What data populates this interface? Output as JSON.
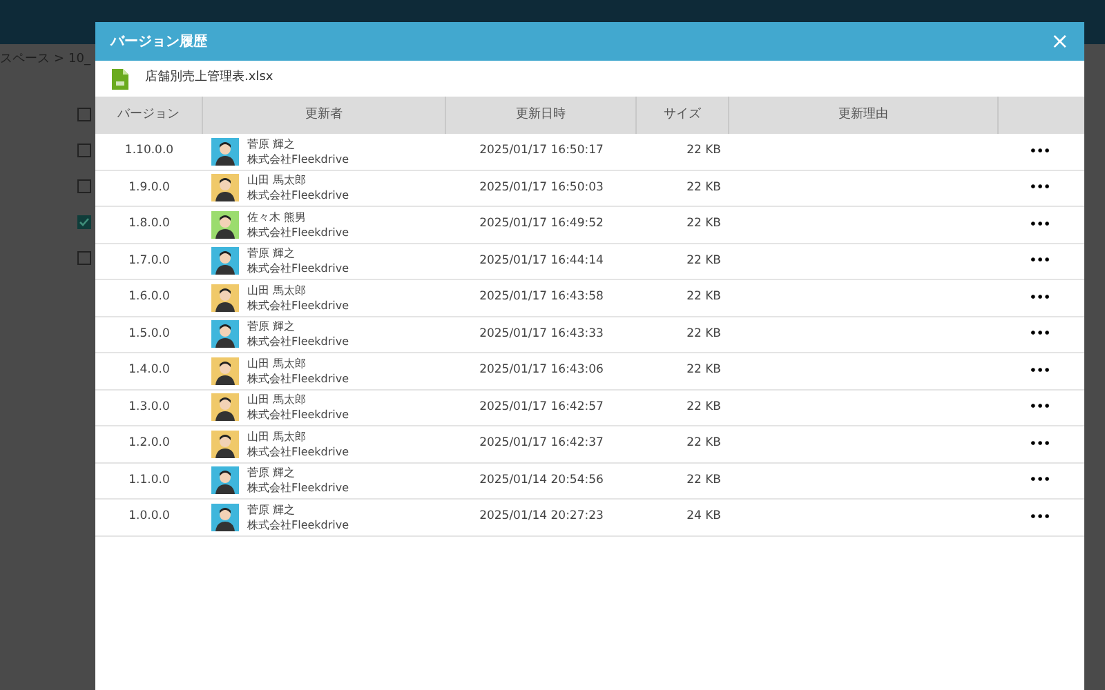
{
  "background": {
    "breadcrumb": [
      "スペース",
      ">",
      "10_"
    ],
    "checkboxes": [
      {
        "checked": false
      },
      {
        "checked": false
      },
      {
        "checked": false
      },
      {
        "checked": true
      },
      {
        "checked": false
      }
    ]
  },
  "dialog": {
    "title": "バージョン履歴",
    "close": "×",
    "file": {
      "name": "店舗別売上管理表.xlsx"
    },
    "columns": [
      "バージョン",
      "更新者",
      "更新日時",
      "サイズ",
      "更新理由"
    ],
    "rows": [
      {
        "version": "1.10.0.0",
        "name": "菅原 輝之",
        "company": "株式会社Fleekdrive",
        "color": "#3fb6dc",
        "date": "2025/01/17 16:50:17",
        "size": "22 KB",
        "menu": "•••"
      },
      {
        "version": "1.9.0.0",
        "name": "山田 馬太郎",
        "company": "株式会社Fleekdrive",
        "color": "#f0c96a",
        "date": "2025/01/17 16:50:03",
        "size": "22 KB",
        "menu": "•••"
      },
      {
        "version": "1.8.0.0",
        "name": "佐々木 熊男",
        "company": "株式会社Fleekdrive",
        "color": "#9bdc6e",
        "date": "2025/01/17 16:49:52",
        "size": "22 KB",
        "menu": "•••"
      },
      {
        "version": "1.7.0.0",
        "name": "菅原 輝之",
        "company": "株式会社Fleekdrive",
        "color": "#3fb6dc",
        "date": "2025/01/17 16:44:14",
        "size": "22 KB",
        "menu": "•••"
      },
      {
        "version": "1.6.0.0",
        "name": "山田 馬太郎",
        "company": "株式会社Fleekdrive",
        "color": "#f0c96a",
        "date": "2025/01/17 16:43:58",
        "size": "22 KB",
        "menu": "•••"
      },
      {
        "version": "1.5.0.0",
        "name": "菅原 輝之",
        "company": "株式会社Fleekdrive",
        "color": "#3fb6dc",
        "date": "2025/01/17 16:43:33",
        "size": "22 KB",
        "menu": "•••"
      },
      {
        "version": "1.4.0.0",
        "name": "山田 馬太郎",
        "company": "株式会社Fleekdrive",
        "color": "#f0c96a",
        "date": "2025/01/17 16:43:06",
        "size": "22 KB",
        "menu": "•••"
      },
      {
        "version": "1.3.0.0",
        "name": "山田 馬太郎",
        "company": "株式会社Fleekdrive",
        "color": "#f0c96a",
        "date": "2025/01/17 16:42:57",
        "size": "22 KB",
        "menu": "•••"
      },
      {
        "version": "1.2.0.0",
        "name": "山田 馬太郎",
        "company": "株式会社Fleekdrive",
        "color": "#f0c96a",
        "date": "2025/01/17 16:42:37",
        "size": "22 KB",
        "menu": "•••"
      },
      {
        "version": "1.1.0.0",
        "name": "菅原 輝之",
        "company": "株式会社Fleekdrive",
        "color": "#3fb6dc",
        "date": "2025/01/14 20:54:56",
        "size": "22 KB",
        "menu": "•••"
      },
      {
        "version": "1.0.0.0",
        "name": "菅原 輝之",
        "company": "株式会社Fleekdrive",
        "color": "#3fb6dc",
        "date": "2025/01/14 20:27:23",
        "size": "24 KB",
        "menu": "•••"
      }
    ]
  }
}
